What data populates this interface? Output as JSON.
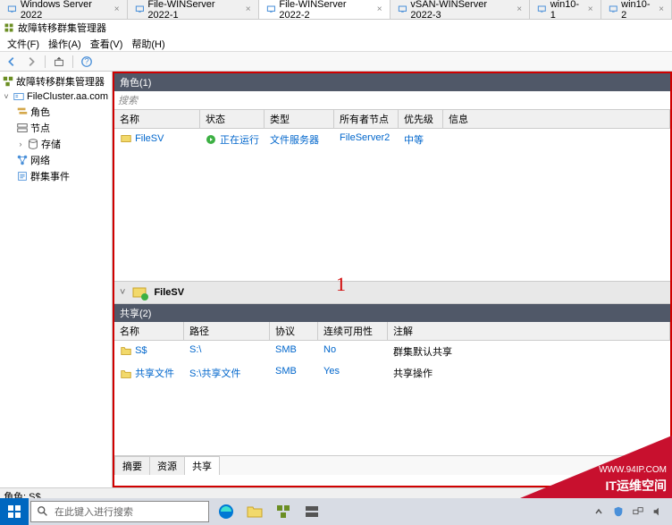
{
  "tabs": [
    {
      "label": "Windows Server 2022"
    },
    {
      "label": "File-WINServer 2022-1"
    },
    {
      "label": "File-WINServer 2022-2"
    },
    {
      "label": "vSAN-WINServer 2022-3"
    },
    {
      "label": "win10-1"
    },
    {
      "label": "win10-2"
    }
  ],
  "window": {
    "title": "故障转移群集管理器"
  },
  "menu": {
    "file": "文件(F)",
    "action": "操作(A)",
    "view": "查看(V)",
    "help": "帮助(H)"
  },
  "tree": {
    "root": "故障转移群集管理器",
    "cluster": "FileCluster.aa.com",
    "roles": "角色",
    "nodes": "节点",
    "storage": "存储",
    "networks": "网络",
    "events": "群集事件"
  },
  "roles": {
    "header": "角色(1)",
    "search": "搜索",
    "cols": {
      "name": "名称",
      "status": "状态",
      "type": "类型",
      "owner": "所有者节点",
      "priority": "优先级",
      "info": "信息"
    },
    "rows": [
      {
        "name": "FileSV",
        "status": "正在运行",
        "type": "文件服务器",
        "owner": "FileServer2",
        "priority": "中等",
        "info": ""
      }
    ]
  },
  "detail": {
    "name": "FileSV",
    "sharesHeader": "共享(2)",
    "cols": {
      "name": "名称",
      "path": "路径",
      "protocol": "协议",
      "continuous": "连续可用性",
      "note": "注解"
    },
    "rows": [
      {
        "name": "S$",
        "path": "S:\\",
        "protocol": "SMB",
        "continuous": "No",
        "note": "群集默认共享"
      },
      {
        "name": "共享文件",
        "path": "S:\\共享文件",
        "protocol": "SMB",
        "continuous": "Yes",
        "note": "共享操作"
      }
    ],
    "tabs": {
      "summary": "摘要",
      "resources": "资源",
      "shares": "共享"
    }
  },
  "red": {
    "label": "1"
  },
  "status": {
    "text": "角色: S$"
  },
  "taskbar": {
    "searchPlaceholder": "在此键入进行搜索"
  },
  "watermark": {
    "url": "WWW.94IP.COM",
    "text": "IT运维空间"
  }
}
